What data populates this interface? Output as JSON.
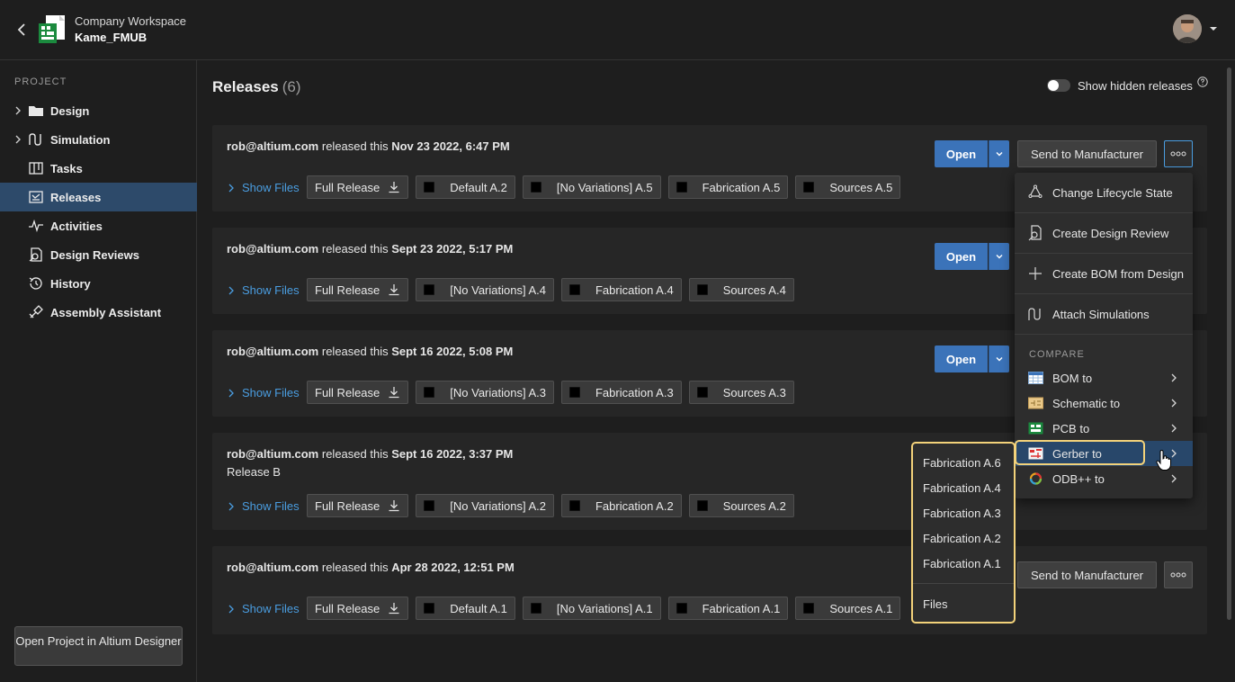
{
  "header": {
    "workspace": "Company Workspace",
    "project": "Kame_FMUB"
  },
  "sidebar": {
    "section_label": "PROJECT",
    "items": [
      {
        "label": "Design",
        "icon": "folder-icon"
      },
      {
        "label": "Simulation",
        "icon": "simulation-icon"
      },
      {
        "label": "Tasks",
        "icon": "tasks-icon"
      },
      {
        "label": "Releases",
        "icon": "releases-icon",
        "active": true
      },
      {
        "label": "Activities",
        "icon": "activities-icon"
      },
      {
        "label": "Design Reviews",
        "icon": "design-reviews-icon"
      },
      {
        "label": "History",
        "icon": "history-icon"
      },
      {
        "label": "Assembly Assistant",
        "icon": "assembly-assistant-icon"
      }
    ],
    "open_project_label": "Open Project in Altium Designer"
  },
  "main": {
    "title": "Releases",
    "count": "(6)",
    "toggle_label": "Show hidden releases",
    "show_files": "Show Files",
    "open_label": "Open",
    "send_label": "Send to Manufacturer",
    "releases": [
      {
        "user": "rob@altium.com",
        "action": "released this",
        "date": "Nov 23 2022, 6:47 PM",
        "note": "",
        "full_release": "Full Release",
        "chips": [
          "Default A.2",
          "[No Variations] A.5",
          "Fabrication A.5",
          "Sources A.5"
        ]
      },
      {
        "user": "rob@altium.com",
        "action": "released this",
        "date": "Sept 23 2022, 5:17 PM",
        "note": "",
        "full_release": "Full Release",
        "chips": [
          "[No Variations] A.4",
          "Fabrication A.4",
          "Sources A.4"
        ]
      },
      {
        "user": "rob@altium.com",
        "action": "released this",
        "date": "Sept 16 2022, 5:08 PM",
        "note": "",
        "full_release": "Full Release",
        "chips": [
          "[No Variations] A.3",
          "Fabrication A.3",
          "Sources A.3"
        ]
      },
      {
        "user": "rob@altium.com",
        "action": "released this",
        "date": "Sept 16 2022, 3:37 PM",
        "note": "Release B",
        "full_release": "Full Release",
        "chips": [
          "[No Variations] A.2",
          "Fabrication A.2",
          "Sources A.2"
        ]
      },
      {
        "user": "rob@altium.com",
        "action": "released this",
        "date": "Apr 28 2022, 12:51 PM",
        "note": "",
        "full_release": "Full Release",
        "chips": [
          "Default A.1",
          "[No Variations] A.1",
          "Fabrication A.1",
          "Sources A.1"
        ]
      }
    ]
  },
  "menu": {
    "items": [
      {
        "label": "Change Lifecycle State",
        "icon": "lifecycle-icon"
      },
      {
        "label": "Create Design Review",
        "icon": "design-review-icon"
      },
      {
        "label": "Create BOM from Design",
        "icon": "plus-icon"
      },
      {
        "label": "Attach Simulations",
        "icon": "simulation-icon"
      }
    ],
    "compare_label": "COMPARE",
    "compare_items": [
      {
        "label": "BOM to",
        "icon": "bom-icon"
      },
      {
        "label": "Schematic to",
        "icon": "schematic-icon"
      },
      {
        "label": "PCB to",
        "icon": "pcb-icon"
      },
      {
        "label": "Gerber to",
        "icon": "gerber-icon"
      },
      {
        "label": "ODB++ to",
        "icon": "odb-icon"
      }
    ]
  },
  "submenu": {
    "items": [
      "Fabrication A.6",
      "Fabrication A.4",
      "Fabrication A.3",
      "Fabrication A.2",
      "Fabrication A.1"
    ],
    "files_label": "Files"
  },
  "colors": {
    "accent": "#3b73b9",
    "link": "#4a9de0",
    "highlight": "#f3d27a",
    "active_nav": "#2d4a6a"
  }
}
